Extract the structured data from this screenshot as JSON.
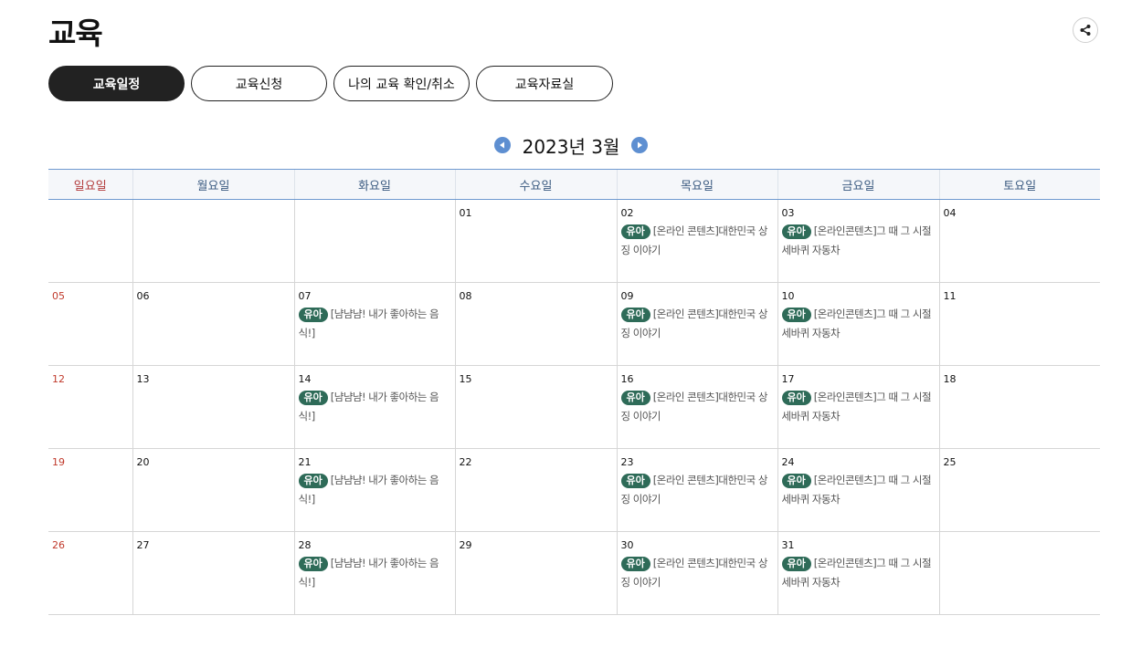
{
  "page": {
    "title": "교육"
  },
  "tabs": [
    {
      "label": "교육일정",
      "active": true
    },
    {
      "label": "교육신청",
      "active": false
    },
    {
      "label": "나의 교육 확인/취소",
      "active": false
    },
    {
      "label": "교육자료실",
      "active": false
    }
  ],
  "calendar": {
    "month_title": "2023년 3월",
    "weekdays": [
      "일요일",
      "월요일",
      "화요일",
      "수요일",
      "목요일",
      "금요일",
      "토요일"
    ],
    "weeks": [
      [
        {
          "day": "",
          "events": []
        },
        {
          "day": "",
          "events": []
        },
        {
          "day": "",
          "events": []
        },
        {
          "day": "01",
          "events": []
        },
        {
          "day": "02",
          "events": [
            {
              "badge": "유아",
              "title": "[온라인 콘텐츠]대한민국 상징 이야기"
            }
          ]
        },
        {
          "day": "03",
          "events": [
            {
              "badge": "유아",
              "title": "[온라인콘텐츠]그 때 그 시절 세바퀴 자동차"
            }
          ]
        },
        {
          "day": "04",
          "events": []
        }
      ],
      [
        {
          "day": "05",
          "events": []
        },
        {
          "day": "06",
          "events": []
        },
        {
          "day": "07",
          "events": [
            {
              "badge": "유아",
              "title": "[냠냠냠! 내가 좋아하는 음식!]"
            }
          ]
        },
        {
          "day": "08",
          "events": []
        },
        {
          "day": "09",
          "events": [
            {
              "badge": "유아",
              "title": "[온라인 콘텐츠]대한민국 상징 이야기"
            }
          ]
        },
        {
          "day": "10",
          "events": [
            {
              "badge": "유아",
              "title": "[온라인콘텐츠]그 때 그 시절 세바퀴 자동차"
            }
          ]
        },
        {
          "day": "11",
          "events": []
        }
      ],
      [
        {
          "day": "12",
          "events": []
        },
        {
          "day": "13",
          "events": []
        },
        {
          "day": "14",
          "events": [
            {
              "badge": "유아",
              "title": "[냠냠냠! 내가 좋아하는 음식!]"
            }
          ]
        },
        {
          "day": "15",
          "events": []
        },
        {
          "day": "16",
          "events": [
            {
              "badge": "유아",
              "title": "[온라인 콘텐츠]대한민국 상징 이야기"
            }
          ]
        },
        {
          "day": "17",
          "events": [
            {
              "badge": "유아",
              "title": "[온라인콘텐츠]그 때 그 시절 세바퀴 자동차"
            }
          ]
        },
        {
          "day": "18",
          "events": []
        }
      ],
      [
        {
          "day": "19",
          "events": []
        },
        {
          "day": "20",
          "events": []
        },
        {
          "day": "21",
          "events": [
            {
              "badge": "유아",
              "title": "[냠냠냠! 내가 좋아하는 음식!]"
            }
          ]
        },
        {
          "day": "22",
          "events": []
        },
        {
          "day": "23",
          "events": [
            {
              "badge": "유아",
              "title": "[온라인 콘텐츠]대한민국 상징 이야기"
            }
          ]
        },
        {
          "day": "24",
          "events": [
            {
              "badge": "유아",
              "title": "[온라인콘텐츠]그 때 그 시절 세바퀴 자동차"
            }
          ]
        },
        {
          "day": "25",
          "events": []
        }
      ],
      [
        {
          "day": "26",
          "events": []
        },
        {
          "day": "27",
          "events": []
        },
        {
          "day": "28",
          "events": [
            {
              "badge": "유아",
              "title": "[냠냠냠! 내가 좋아하는 음식!]"
            }
          ]
        },
        {
          "day": "29",
          "events": []
        },
        {
          "day": "30",
          "events": [
            {
              "badge": "유아",
              "title": "[온라인 콘텐츠]대한민국 상징 이야기"
            }
          ]
        },
        {
          "day": "31",
          "events": [
            {
              "badge": "유아",
              "title": "[온라인콘텐츠]그 때 그 시절 세바퀴 자동차"
            }
          ]
        },
        {
          "day": "",
          "events": []
        }
      ]
    ]
  },
  "icons": {
    "share": "share-icon",
    "prev": "prev-month-icon",
    "next": "next-month-icon"
  },
  "colors": {
    "badge": "#2e6b58",
    "sunday": "#c0392b",
    "header_text": "#3a5a80",
    "nav_arrow": "#5e8fd1",
    "active_tab": "#222222"
  }
}
